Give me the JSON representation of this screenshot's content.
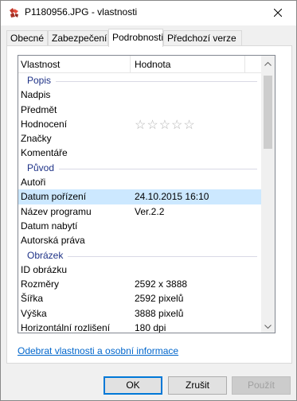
{
  "window": {
    "title": "P1180956.JPG - vlastnosti",
    "app_icon": "camera-icon",
    "close_icon": "close-icon"
  },
  "tabs": [
    {
      "label": "Obecné",
      "active": false
    },
    {
      "label": "Zabezpečení",
      "active": false
    },
    {
      "label": "Podrobnosti",
      "active": true
    },
    {
      "label": "Předchozí verze",
      "active": false
    }
  ],
  "list": {
    "header": {
      "property": "Vlastnost",
      "value": "Hodnota"
    },
    "groups": {
      "popis": "Popis",
      "puvod": "Původ",
      "obrazek": "Obrázek"
    },
    "rows": {
      "nadpis": {
        "name": "Nadpis",
        "value": ""
      },
      "predmet": {
        "name": "Předmět",
        "value": ""
      },
      "hodnoceni": {
        "name": "Hodnocení",
        "stars": "☆☆☆☆☆",
        "rating": 0,
        "max": 5
      },
      "znacky": {
        "name": "Značky",
        "value": ""
      },
      "komentare": {
        "name": "Komentáře",
        "value": ""
      },
      "autori": {
        "name": "Autoři",
        "value": ""
      },
      "datum_porizeni": {
        "name": "Datum pořízení",
        "value": "24.10.2015 16:10",
        "selected": true
      },
      "nazev_programu": {
        "name": "Název programu",
        "value": "Ver.2.2"
      },
      "datum_nabyti": {
        "name": "Datum nabytí",
        "value": ""
      },
      "autorska_prava": {
        "name": "Autorská práva",
        "value": ""
      },
      "id_obrazku": {
        "name": "ID obrázku",
        "value": ""
      },
      "rozmery": {
        "name": "Rozměry",
        "value": "2592 x 3888"
      },
      "sirka": {
        "name": "Šířka",
        "value": "2592 pixelů"
      },
      "vyska": {
        "name": "Výška",
        "value": "3888 pixelů"
      },
      "horiz": {
        "name": "Horizontální rozlišení",
        "value": "180 dpi"
      }
    }
  },
  "remove_link": "Odebrat vlastnosti a osobní informace",
  "buttons": {
    "ok": "OK",
    "cancel": "Zrušit",
    "apply": "Použít"
  },
  "colors": {
    "selection": "#cce8ff",
    "group_title": "#1e3287",
    "link": "#0066cc",
    "default_button_border": "#0078d7"
  }
}
